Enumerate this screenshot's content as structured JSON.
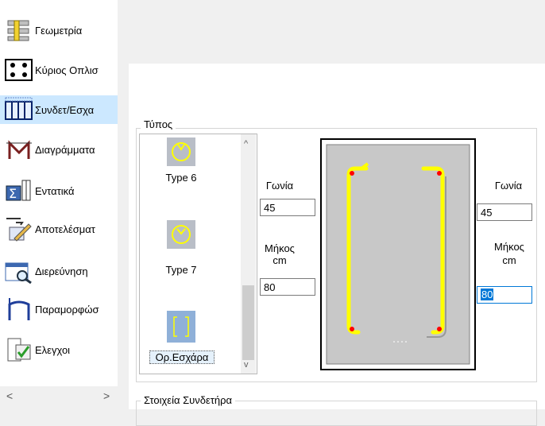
{
  "nav": {
    "items": [
      {
        "label": "Γεωμετρία",
        "icon": "geometry-icon"
      },
      {
        "label": "Κύριος Οπλισ",
        "icon": "main-rebar-icon"
      },
      {
        "label": "Συνδετ/Εσχα",
        "icon": "stirrup-mesh-icon"
      },
      {
        "label": "Διαγράμματα",
        "icon": "diagram-icon"
      },
      {
        "label": "Εντατικά",
        "icon": "sigma-forces-icon"
      },
      {
        "label": "Αποτελέσματ",
        "icon": "results-edit-icon"
      },
      {
        "label": "Διερεύνηση",
        "icon": "investigation-icon"
      },
      {
        "label": "Παραμορφώσ",
        "icon": "deformation-icon"
      },
      {
        "label": "Ελεγχοι",
        "icon": "checks-icon"
      }
    ],
    "scroll_left": "<",
    "scroll_right": ">"
  },
  "type_group": {
    "legend": "Τύπος",
    "list": [
      {
        "name": "Type 6",
        "icon": "stirrup-circle-icon"
      },
      {
        "name": "Type 7",
        "icon": "stirrup-circle-icon"
      },
      {
        "name": "Ορ.Εσχάρα",
        "icon": "mesh-rect-icon"
      }
    ],
    "scroll_up": "^",
    "scroll_down": "v"
  },
  "left_params": {
    "angle_label": "Γωνία",
    "angle_value": "45",
    "length_label_1": "Μήκος",
    "length_label_2": "cm",
    "length_value": "80"
  },
  "right_params": {
    "angle_label": "Γωνία",
    "angle_value": "45",
    "length_label_1": "Μήκος",
    "length_label_2": "cm",
    "length_value": "80"
  },
  "stirrup_group": {
    "legend": "Στοιχεία Συνδετήρα"
  },
  "colors": {
    "rebar": "#ffff00",
    "section_fill": "#c8c8c8",
    "node": "#ff0000",
    "accent": "#0078d7"
  }
}
